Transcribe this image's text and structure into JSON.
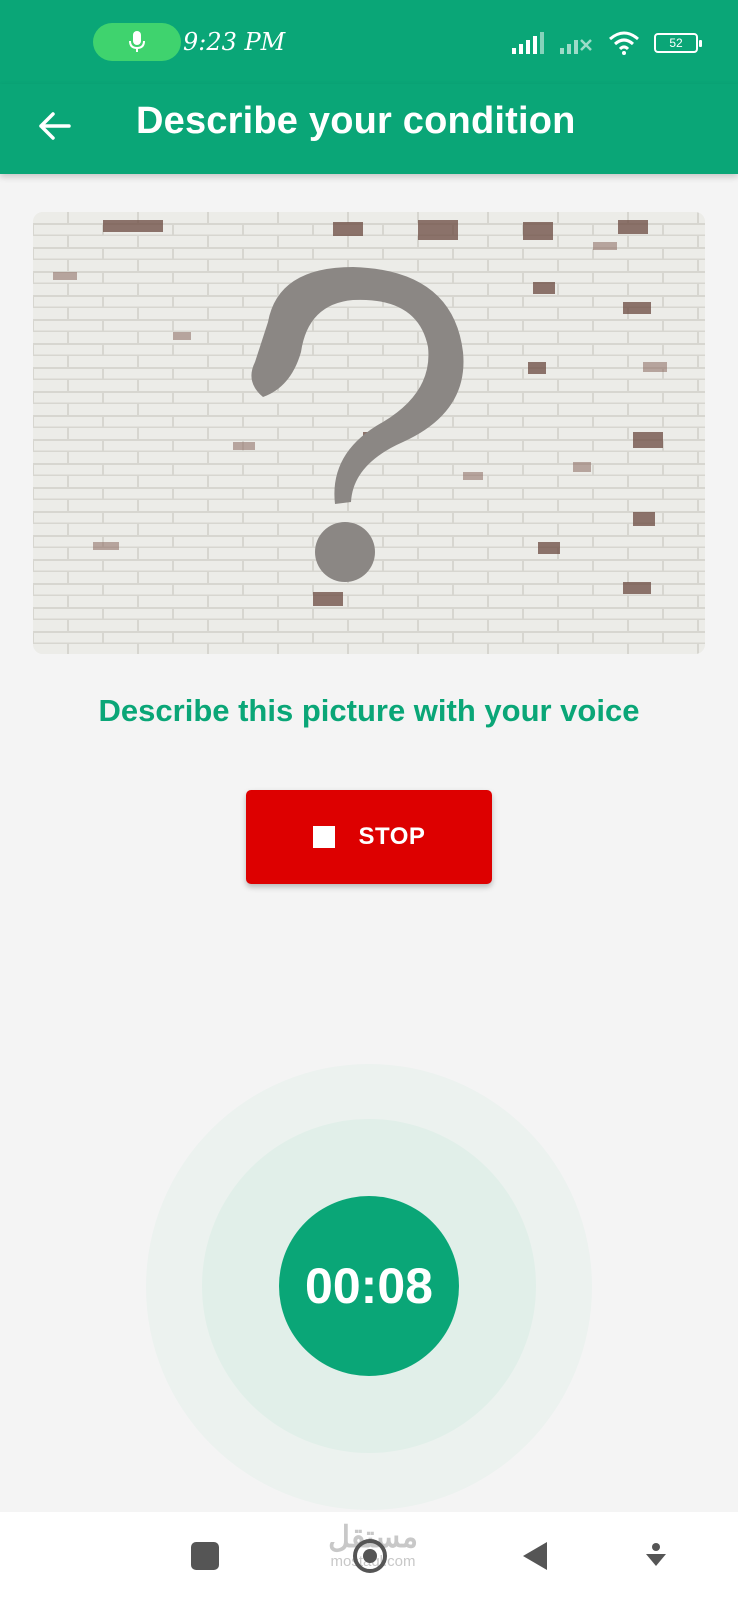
{
  "status_bar": {
    "time": "9:23 PM",
    "battery": "52",
    "icons": [
      "microphone-icon",
      "signal-icon",
      "signal-no-service-icon",
      "wifi-icon",
      "battery-icon"
    ]
  },
  "app_bar": {
    "title": "Describe your condition",
    "back_icon": "arrow-left-icon"
  },
  "picture": {
    "subject": "question-mark-on-brick-wall"
  },
  "instruction": "Describe this picture with your voice",
  "stop_button": {
    "label": "STOP",
    "icon": "stop-square-icon"
  },
  "timer": {
    "value": "00:08"
  },
  "nav_bar": {
    "items": [
      "recents-icon",
      "home-icon",
      "back-icon",
      "assistant-icon"
    ],
    "watermark_top": "مستقل",
    "watermark_bottom": "mostaql.com"
  },
  "colors": {
    "primary": "#0aa677",
    "stop": "#dd0000",
    "background": "#f4f4f4",
    "mic_pill": "#3fd36e"
  }
}
